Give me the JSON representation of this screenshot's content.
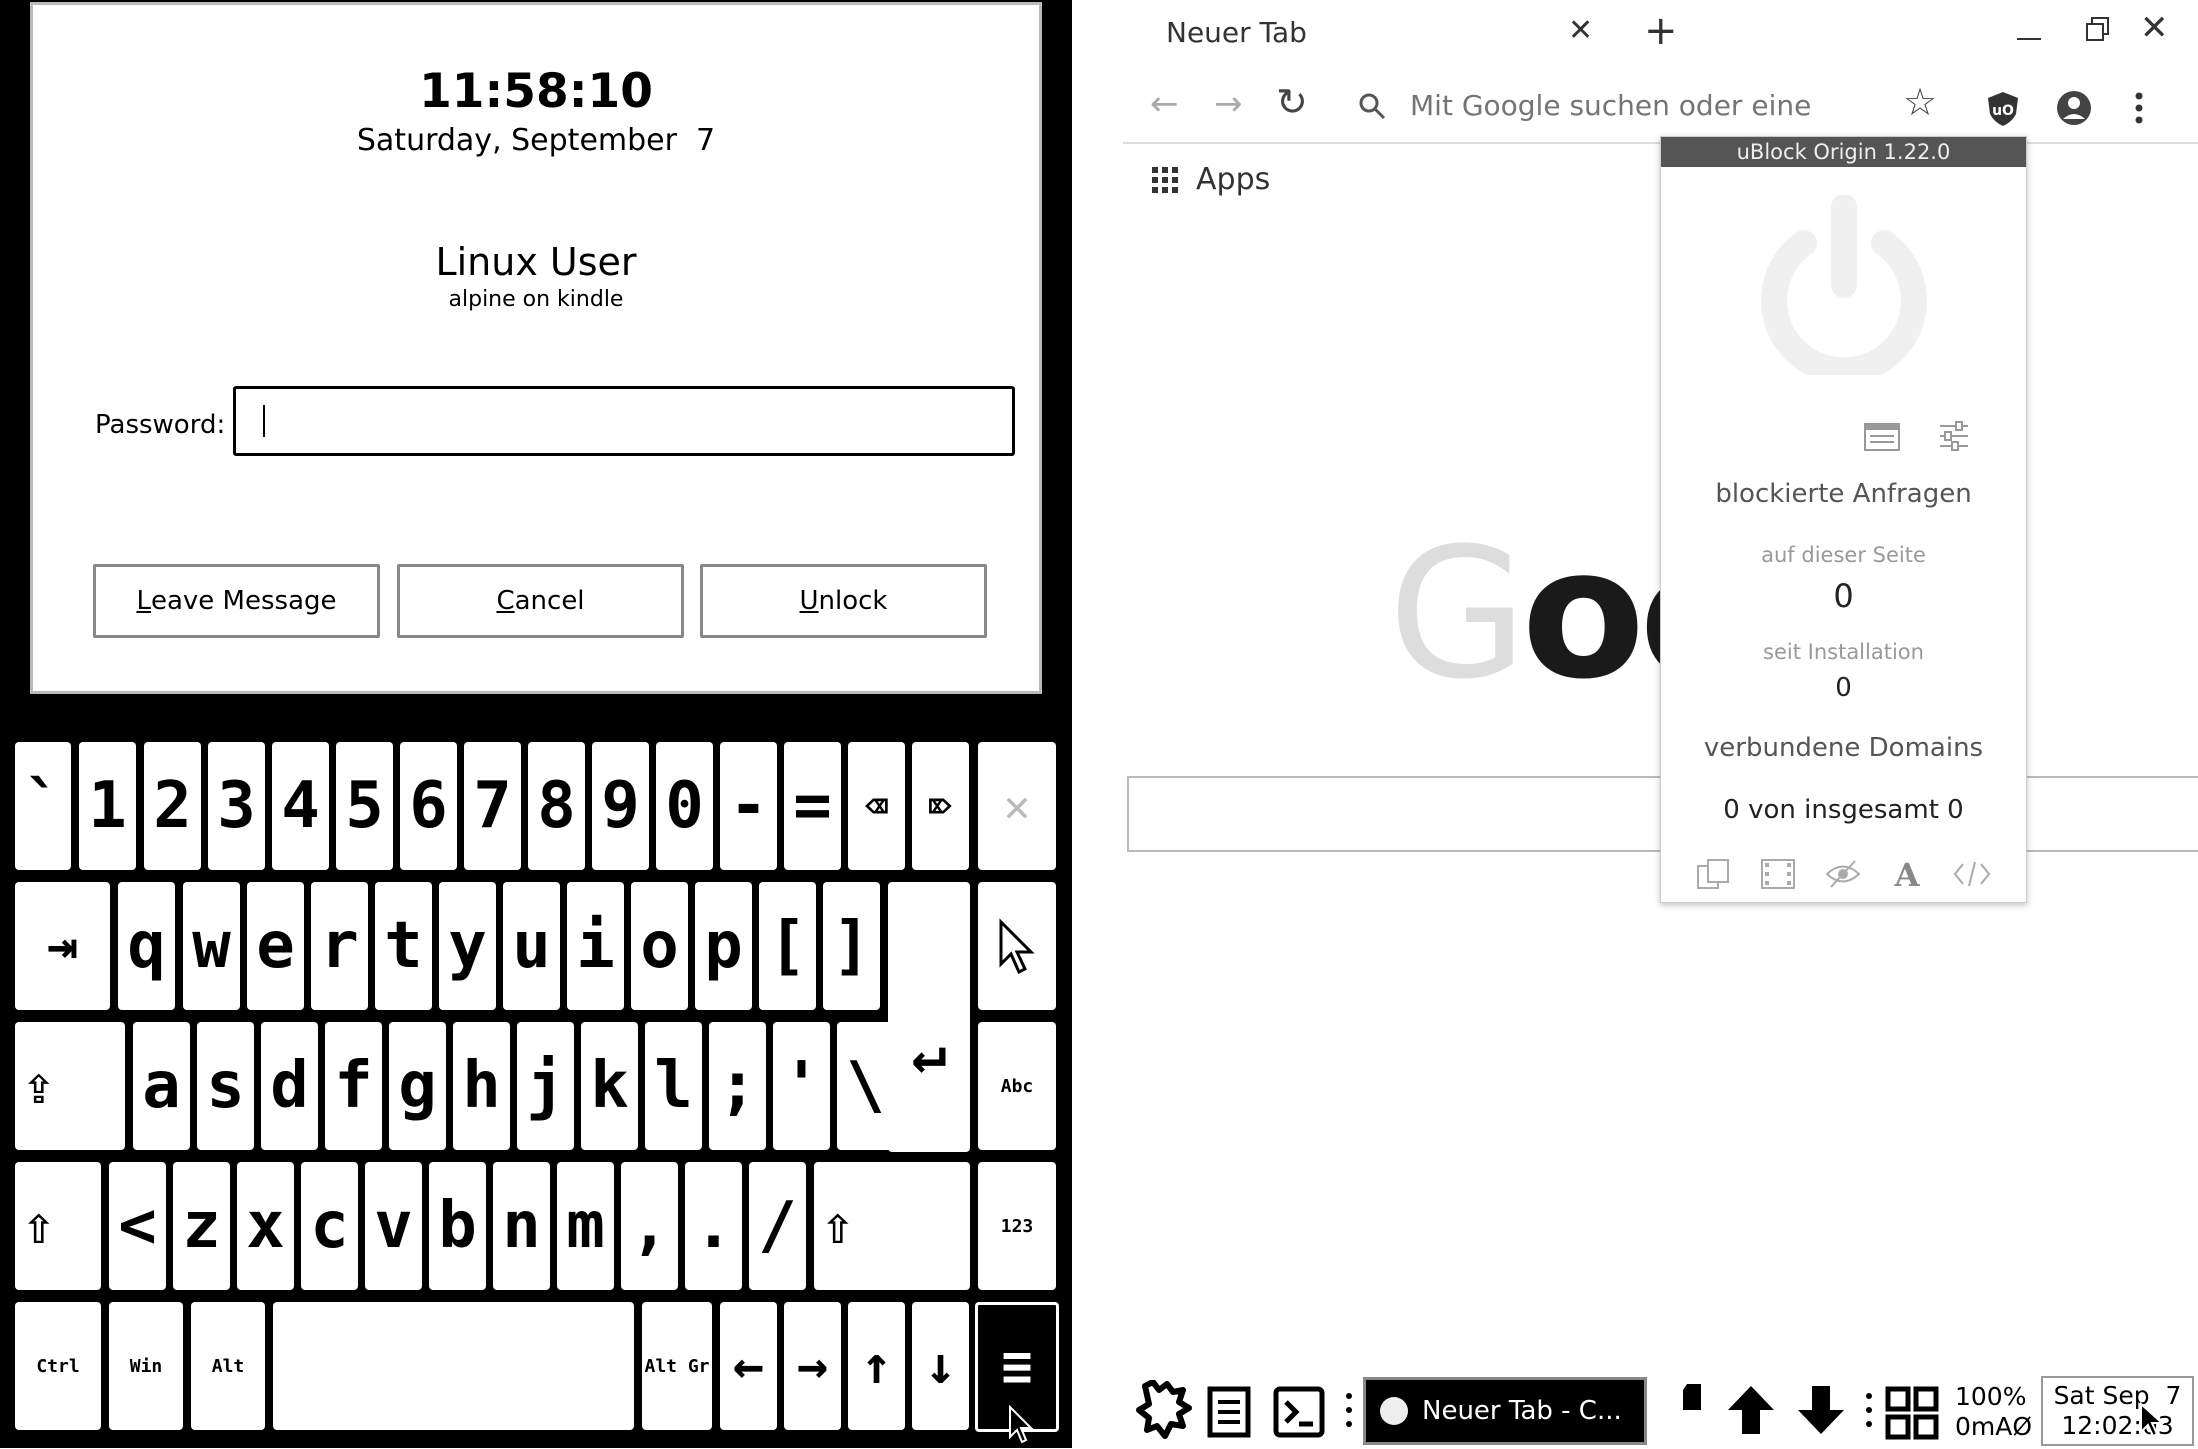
{
  "lock": {
    "time": "11:58:10",
    "date": "Saturday, September  7",
    "user": "Linux User",
    "host": "alpine on kindle",
    "password_label": "Password:",
    "password_value": "",
    "buttons": {
      "leave_message": {
        "mnemonic": "L",
        "rest": "eave Message"
      },
      "cancel": {
        "mnemonic": "C",
        "rest": "ancel"
      },
      "unlock": {
        "mnemonic": "U",
        "rest": "nlock"
      }
    }
  },
  "keyboard": {
    "rows": [
      [
        "`",
        "1",
        "2",
        "3",
        "4",
        "5",
        "6",
        "7",
        "8",
        "9",
        "0",
        "-",
        "="
      ],
      [
        "q",
        "w",
        "e",
        "r",
        "t",
        "y",
        "u",
        "i",
        "o",
        "p",
        "[",
        "]"
      ],
      [
        "a",
        "s",
        "d",
        "f",
        "g",
        "h",
        "j",
        "k",
        "l",
        ";",
        "'",
        "\\"
      ],
      [
        "<",
        "z",
        "x",
        "c",
        "v",
        "b",
        "n",
        "m",
        ",",
        ".",
        "/"
      ]
    ],
    "labels": {
      "backspace": "⌫",
      "delete": "⌦",
      "close": "✕",
      "tab": "⇥",
      "enter": "↵",
      "caps": "⇪",
      "shift": "⇧",
      "abc": "Abc",
      "num": "123",
      "ctrl": "Ctrl",
      "win": "Win",
      "alt": "Alt",
      "altgr": "Alt Gr",
      "left": "←",
      "right": "→",
      "up": "↑",
      "down": "↓",
      "menu": "≡"
    }
  },
  "browser": {
    "tab_title": "Neuer Tab",
    "omnibox_placeholder": "Mit Google suchen oder eine URL",
    "apps_label": "Apps",
    "google_partial": "Goo",
    "icons": [
      "close-icon",
      "plus-icon",
      "minimize-icon",
      "maximize-icon",
      "back-arrow-icon",
      "forward-arrow-icon",
      "reload-icon",
      "search-icon",
      "star-icon",
      "ublock-shield-icon",
      "account-icon",
      "more-vert-icon",
      "apps-grid-icon"
    ]
  },
  "ublock": {
    "title": "uBlock Origin 1.22.0",
    "blocked_heading": "blockierte Anfragen",
    "on_page_label": "auf dieser Seite",
    "on_page_value": "0",
    "since_install_label": "seit Installation",
    "since_install_value": "0",
    "domains_heading": "verbundene Domains",
    "domains_value": "0 von insgesamt 0",
    "icons": [
      "power-icon",
      "logger-icon",
      "dashboard-icon",
      "popup-block-icon",
      "media-block-icon",
      "cosmetic-filter-icon",
      "font-block-icon",
      "script-block-icon"
    ]
  },
  "taskbar": {
    "task_label": "Neuer Tab - C...",
    "battery_line1": "100%",
    "battery_line2": "0mAØ",
    "clock_line1": "Sat Sep  7",
    "clock_line2": "12:02:03",
    "icons": [
      "menu-launcher-icon",
      "file-manager-icon",
      "terminal-icon",
      "sd-card-icon",
      "up-arrow-icon",
      "down-arrow-icon",
      "grid-layout-icon",
      "mouse-cursor-icon"
    ]
  }
}
